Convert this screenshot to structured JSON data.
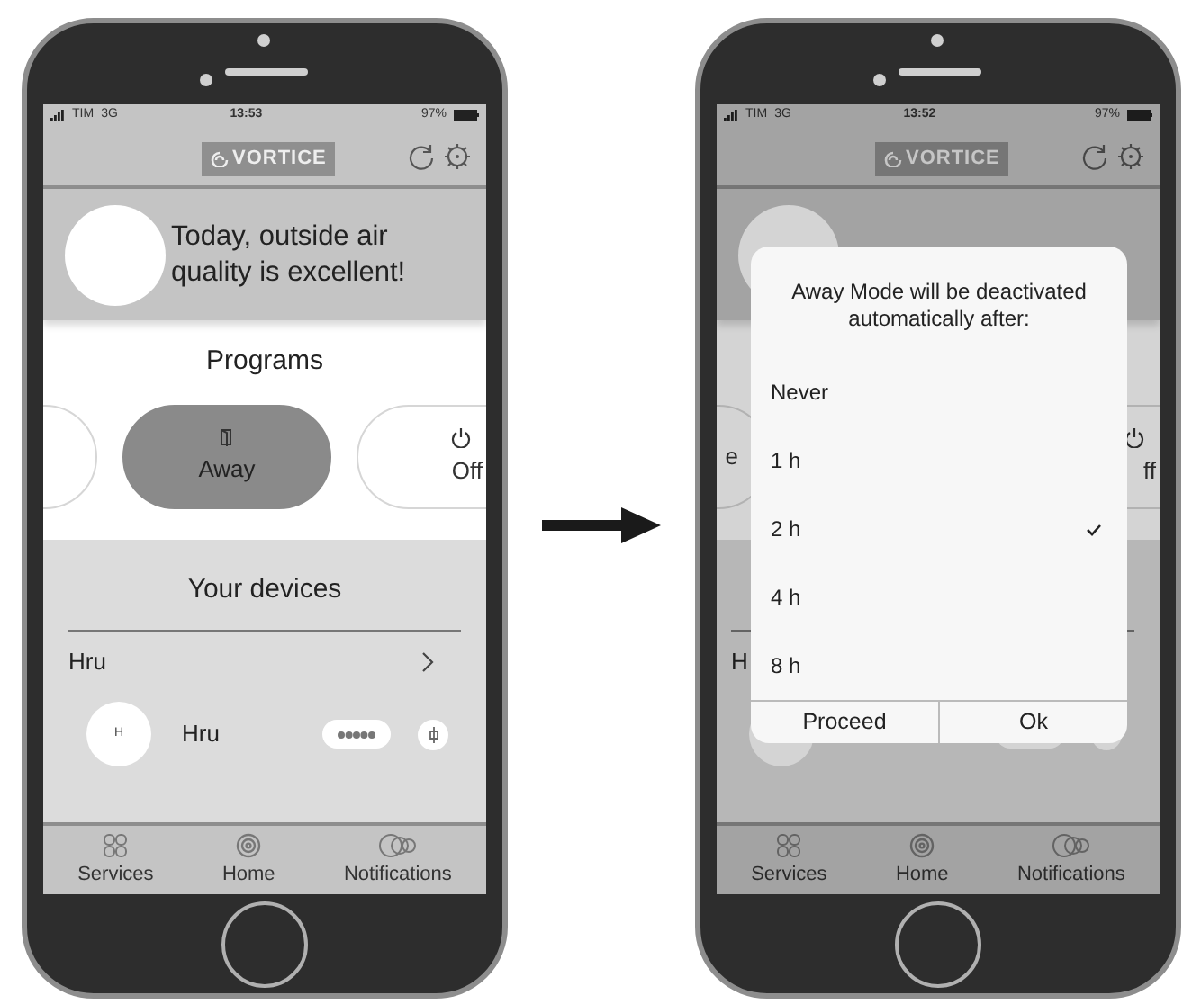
{
  "screens": [
    {
      "status": {
        "carrier": "TIM",
        "network": "3G",
        "time": "13:53",
        "battery": "97%"
      },
      "header": {
        "logo": "VORTICE"
      },
      "banner": {
        "message": "Today, outside air quality is excellent!"
      },
      "programs": {
        "title": "Programs",
        "items": [
          {
            "kind": "left-edge",
            "selected": false
          },
          {
            "kind": "center",
            "label": "Away",
            "selected": true
          },
          {
            "kind": "right-edge",
            "label": "Off",
            "selected": false
          }
        ]
      },
      "devices": {
        "title": "Your devices",
        "group": "Hru",
        "items": [
          {
            "kind": "device",
            "badge": "H",
            "name": "Hru"
          }
        ]
      },
      "tabs": [
        {
          "label": "Services"
        },
        {
          "label": "Home"
        },
        {
          "label": "Notifications"
        }
      ]
    },
    {
      "status": {
        "carrier": "TIM",
        "network": "3G",
        "time": "13:52",
        "battery": "97%"
      },
      "header": {
        "logo": "VORTICE"
      },
      "programs": {
        "items": [
          {
            "kind": "left-edge",
            "label": "e",
            "selected": false
          },
          {
            "kind": "right-edge",
            "label": "ff",
            "selected": false
          }
        ]
      },
      "devices": {
        "group": "H",
        "items": [
          {
            "kind": "device"
          }
        ]
      },
      "tabs": [
        {
          "label": "Services"
        },
        {
          "label": "Home"
        },
        {
          "label": "Notifications"
        }
      ],
      "dialog": {
        "message": "Away Mode will be deactivated automatically after:",
        "options": [
          {
            "label": "Never",
            "selected": false
          },
          {
            "label": "1 h",
            "selected": false
          },
          {
            "label": "2 h",
            "selected": true
          },
          {
            "label": "4 h",
            "selected": false
          },
          {
            "label": "8 h",
            "selected": false
          }
        ],
        "buttons": [
          "Proceed",
          "Ok"
        ]
      }
    }
  ]
}
